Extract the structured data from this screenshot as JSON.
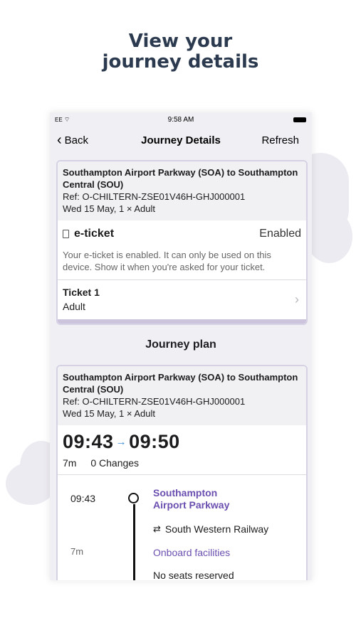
{
  "headline": {
    "line1": "View your",
    "line2": "journey details"
  },
  "status_bar": {
    "carrier": "EE",
    "time": "9:58 AM"
  },
  "nav": {
    "back_label": "Back",
    "title": "Journey Details",
    "refresh_label": "Refresh"
  },
  "ticket_card": {
    "route": "Southampton Airport Parkway (SOA) to Southampton Central (SOU)",
    "ref": "Ref: O-CHILTERN-ZSE01V46H-GHJ000001",
    "date_passengers": "Wed 15 May, 1 × Adult",
    "eticket_label": "e-ticket",
    "eticket_status": "Enabled",
    "eticket_description": "Your e-ticket is enabled. It can only be used on this device. Show it when you're asked for your ticket.",
    "ticket_title": "Ticket 1",
    "ticket_type": "Adult"
  },
  "journey_plan": {
    "title": "Journey plan",
    "route": "Southampton Airport Parkway (SOA) to Southampton Central (SOU)",
    "ref": "Ref: O-CHILTERN-ZSE01V46H-GHJ000001",
    "date_passengers": "Wed 15 May, 1 × Adult",
    "depart_time": "09:43",
    "arrow": "→",
    "arrive_time": "09:50",
    "duration": "7m",
    "changes": "0 Changes",
    "timeline": {
      "depart_time": "09:43",
      "station": "Southampton Airport Parkway",
      "operator": "South Western Railway",
      "duration": "7m",
      "facilities_link": "Onboard facilities",
      "seats": "No seats reserved"
    }
  },
  "icons": {
    "wifi": "wifi-icon",
    "battery": "battery-icon",
    "back": "chevron-left-icon",
    "ticket": "ticket-icon",
    "disclosure": "chevron-right-icon",
    "rail": "national-rail-icon"
  },
  "colors": {
    "headline": "#2b3a4e",
    "accent_purple": "#6b4fb0",
    "card_border": "#d6d1e4",
    "arrow_blue": "#3f8ed8"
  }
}
